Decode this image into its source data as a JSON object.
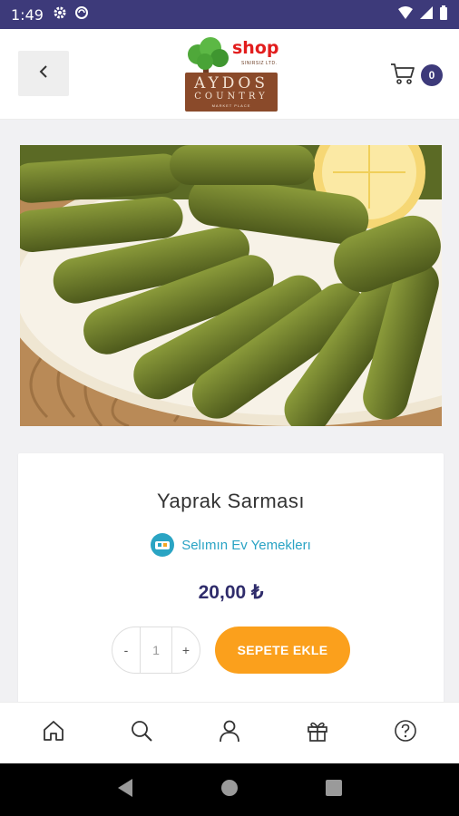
{
  "status_bar": {
    "time": "1:49",
    "icons": [
      "gear-icon",
      "circle-icon",
      "wifi-icon",
      "signal-icon",
      "battery-icon"
    ]
  },
  "header": {
    "back_icon": "chevron-left-icon",
    "logo": {
      "shop": "shop",
      "sub": "SINIRSIZ LTD.",
      "name_line1": "AYDOS",
      "name_line2": "COUNTRY",
      "small_line": "MARKET PLACE"
    },
    "cart_icon": "cart-icon",
    "cart_count": "0"
  },
  "product": {
    "image_alt": "stuffed grape leaves photo",
    "name": "Yaprak Sarması",
    "seller": "Selımın Ev Yemeklerı",
    "price": "20,00 ₺",
    "quantity": "1",
    "decrement_label": "-",
    "increment_label": "+",
    "add_to_cart_label": "SEPETE EKLE"
  },
  "bottom_nav": {
    "items": [
      {
        "icon": "home-icon"
      },
      {
        "icon": "search-icon"
      },
      {
        "icon": "user-icon"
      },
      {
        "icon": "gift-icon"
      },
      {
        "icon": "help-icon"
      }
    ]
  },
  "colors": {
    "brand": "#3d3a7a",
    "accent": "#fba01c",
    "seller_link": "#29a3c4"
  }
}
